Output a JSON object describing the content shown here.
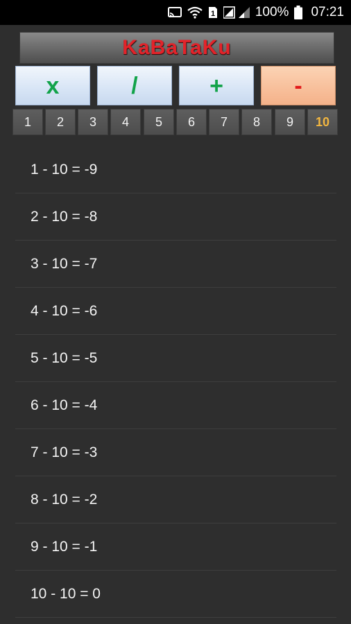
{
  "status_bar": {
    "battery_percent": "100%",
    "time": "07:21",
    "sim_slot": "1",
    "icons": [
      "cast-icon",
      "wifi-icon",
      "sim-1-icon",
      "signal-icon",
      "battery-icon"
    ]
  },
  "app": {
    "title": "KaBaTaKu",
    "title_color": "#e3232a"
  },
  "operators": [
    {
      "symbol": "x",
      "color": "#12a34a",
      "selected": false
    },
    {
      "symbol": "/",
      "color": "#12a34a",
      "selected": false
    },
    {
      "symbol": "+",
      "color": "#12a34a",
      "selected": false
    },
    {
      "symbol": "-",
      "color": "#e21b1b",
      "selected": true
    }
  ],
  "numbers": [
    "1",
    "2",
    "3",
    "4",
    "5",
    "6",
    "7",
    "8",
    "9",
    "10"
  ],
  "selected_number": "10",
  "results": [
    "1 - 10 = -9",
    "2 - 10 = -8",
    "3 - 10 = -7",
    "4 - 10 = -6",
    "5 - 10 = -5",
    "6 - 10 = -4",
    "7 - 10 = -3",
    "8 - 10 = -2",
    "9 - 10 = -1",
    "10 - 10 = 0"
  ]
}
